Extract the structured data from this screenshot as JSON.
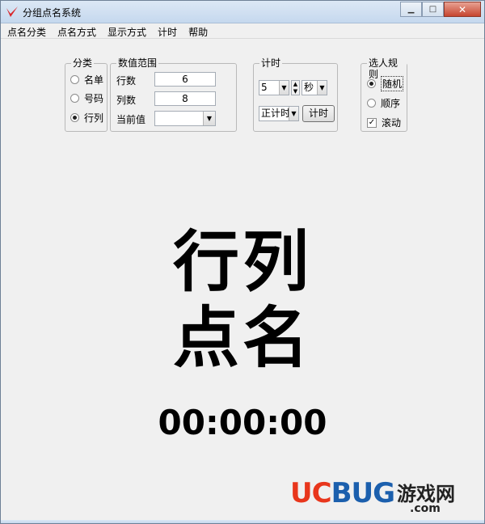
{
  "window": {
    "title": "分组点名系统"
  },
  "menu": [
    "点名分类",
    "点名方式",
    "显示方式",
    "计时",
    "帮助"
  ],
  "category": {
    "title": "分类",
    "options": [
      {
        "label": "名单",
        "selected": false
      },
      {
        "label": "号码",
        "selected": false
      },
      {
        "label": "行列",
        "selected": true
      }
    ]
  },
  "range": {
    "title": "数值范围",
    "rows_label": "行数",
    "rows_value": "6",
    "cols_label": "列数",
    "cols_value": "8",
    "current_label": "当前值",
    "current_value": ""
  },
  "timer": {
    "title": "计时",
    "amount": "5",
    "unit": "秒",
    "mode": "正计时",
    "start_label": "计时"
  },
  "rule": {
    "title": "选人规则",
    "random_label": "随机",
    "random_selected": true,
    "order_label": "顺序",
    "order_selected": false,
    "scroll_label": "滚动",
    "scroll_checked": true
  },
  "display": {
    "line1": "行列",
    "line2": "点名",
    "time": "00:00:00"
  },
  "watermark": {
    "brand_uc": "UC",
    "brand_bug": "BUG",
    "brand_cn": "游戏网",
    "domain": ".com"
  },
  "colors": {
    "brand_red": "#e8361c",
    "brand_blue": "#1b5fad"
  }
}
